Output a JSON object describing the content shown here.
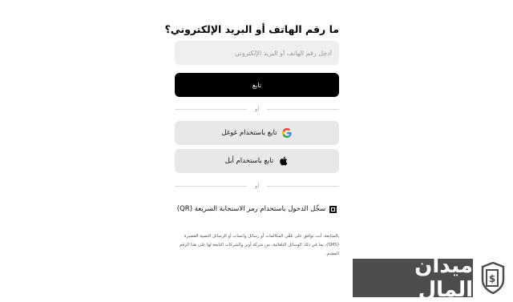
{
  "login": {
    "title": "ما رقم الهاتف أو البريد الإلكتروني؟",
    "input_placeholder": "أدخِل رقم الهاتف أو البريد الإلكتروني",
    "continue_label": "تابع",
    "divider_text": "أو",
    "google_label": "تابع باستخدام غوغل",
    "apple_label": "تابع باستخدام أبل",
    "qr_label": "سجِّل الدخول باستخدام رمز الاستجابة السريعة (QR)",
    "legal_text": "بالمتابعة، أنت توافق على تلقّي المكالمات أو رسائل واتساب أو الرسائل النصية القصيرة (SMS)، بما في ذلك الوسائل التلقائية، من شركة أوبر والشركات التابعة لها على هذا الرقم المقدم."
  },
  "watermark": {
    "text": "ميدان المال"
  },
  "colors": {
    "primary_button": "#000000",
    "secondary_button": "#e8e8e8",
    "input_background": "#efefef",
    "watermark_background": "#4d4d4d"
  }
}
